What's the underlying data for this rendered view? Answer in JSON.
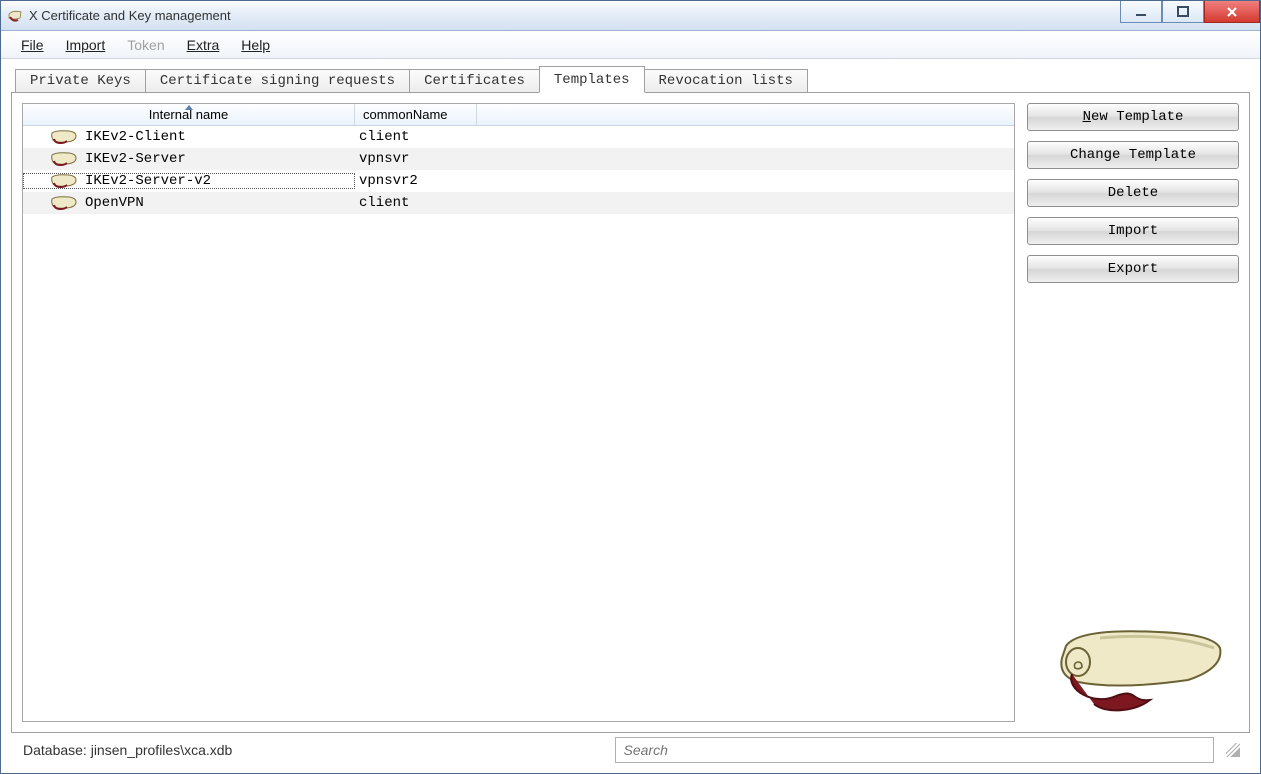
{
  "window": {
    "title": "X Certificate and Key management"
  },
  "menu": {
    "file": "File",
    "import": "Import",
    "token": "Token",
    "extra": "Extra",
    "help": "Help"
  },
  "tabs": {
    "private_keys": "Private Keys",
    "csr": "Certificate signing requests",
    "certificates": "Certificates",
    "templates": "Templates",
    "revocation": "Revocation lists",
    "active": "templates"
  },
  "columns": {
    "internal_name": "Internal name",
    "common_name": "commonName"
  },
  "rows": [
    {
      "name": "IKEv2-Client",
      "cn": "client",
      "selected": false
    },
    {
      "name": "IKEv2-Server",
      "cn": "vpnsvr",
      "selected": false
    },
    {
      "name": "IKEv2-Server-v2",
      "cn": "vpnsvr2",
      "selected": true
    },
    {
      "name": "OpenVPN",
      "cn": "client",
      "selected": false
    }
  ],
  "buttons": {
    "new_template": "New Template",
    "change_template": "Change Template",
    "delete": "Delete",
    "import": "Import",
    "export": "Export"
  },
  "status": {
    "database_label": "Database: jinsen_profiles\\xca.xdb",
    "search_placeholder": "Search"
  }
}
